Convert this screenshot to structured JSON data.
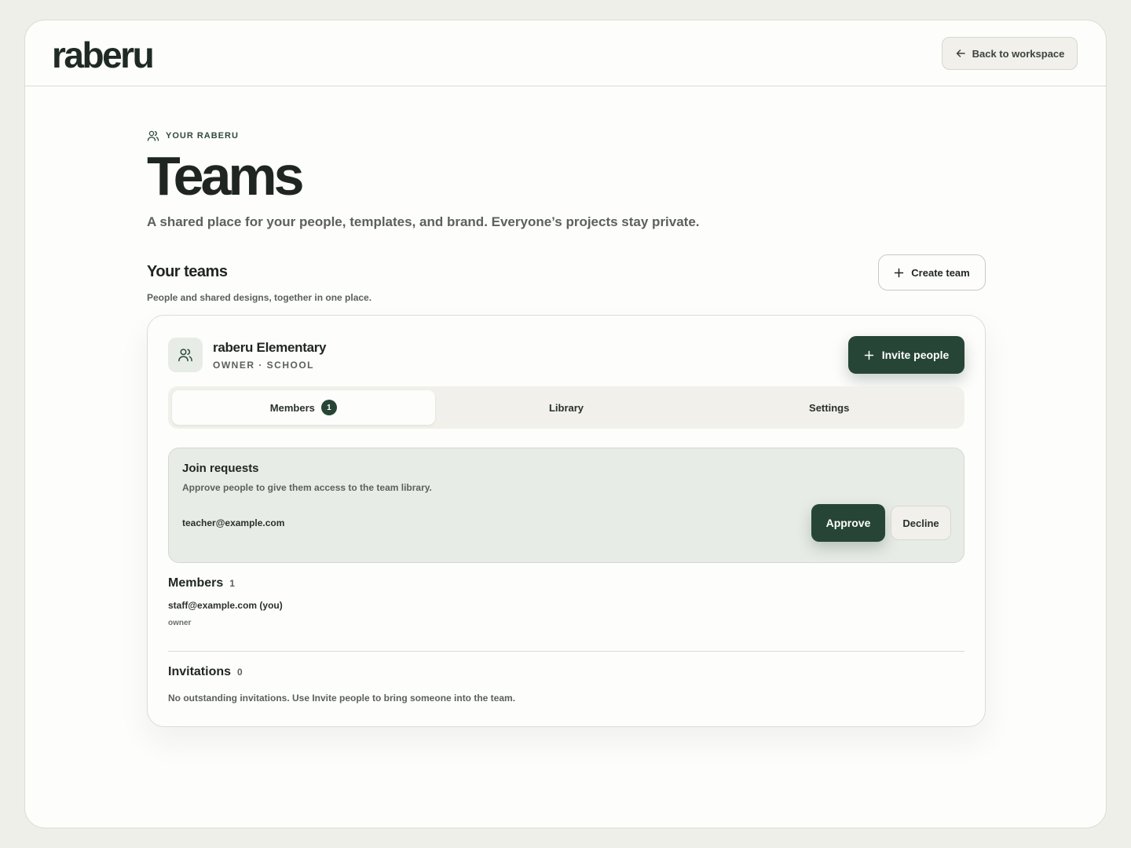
{
  "header": {
    "logo": "raberu",
    "back_label": "Back to workspace"
  },
  "page": {
    "eyebrow": "YOUR RABERU",
    "title": "Teams",
    "subtitle": "A shared place for your people, templates, and brand. Everyone’s projects stay private."
  },
  "teams_section": {
    "title": "Your teams",
    "subtitle": "People and shared designs, together in one place.",
    "create_label": "Create team"
  },
  "team": {
    "name": "raberu Elementary",
    "meta": "OWNER · SCHOOL",
    "invite_label": "Invite people",
    "tabs": [
      {
        "label": "Members",
        "badge": "1",
        "active": true
      },
      {
        "label": "Library"
      },
      {
        "label": "Settings"
      }
    ],
    "join_requests": {
      "title": "Join requests",
      "subtitle": "Approve people to give them access to the team library.",
      "email": "teacher@example.com",
      "approve_label": "Approve",
      "decline_label": "Decline"
    },
    "members": {
      "title": "Members",
      "count": "1",
      "items": [
        {
          "email": "staff@example.com (you)",
          "role": "owner"
        }
      ]
    },
    "invitations": {
      "title": "Invitations",
      "count": "0",
      "empty": "No outstanding invitations. Use Invite people to bring someone into the team."
    }
  },
  "colors": {
    "accent": "#264536",
    "background": "#efefea",
    "surface": "#fdfdfb",
    "request_bg": "#e8ece7"
  }
}
